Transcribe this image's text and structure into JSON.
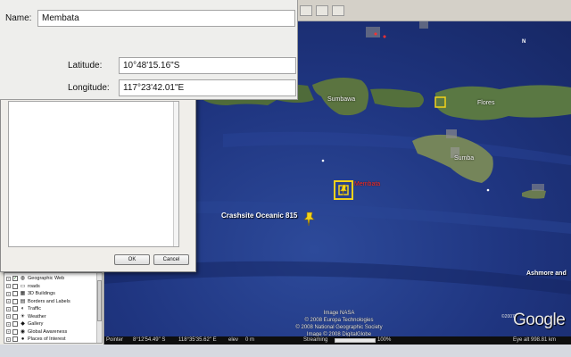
{
  "form": {
    "name_label": "Name:",
    "name_value": "Membata",
    "latitude_label": "Latitude:",
    "latitude_value": "10°48'15.16\"S",
    "longitude_label": "Longitude:",
    "longitude_value": "117°23'42.01\"E"
  },
  "dialog": {
    "ok_label": "OK",
    "cancel_label": "Cancel"
  },
  "map": {
    "labels": {
      "sumbawa": "Sumbawa",
      "flores": "Flores",
      "sumba": "Sumba",
      "membata": "Membata",
      "crashsite": "Crashsite Oceanic 815",
      "ashmore": "Ashmore and"
    },
    "attribution": {
      "line1": "Image NASA",
      "line2": "© 2008 Europa Technologies",
      "line3": "© 2008 National Geographic Society",
      "line4": "Image © 2008 DigitalGlobe"
    },
    "logo_prefix": "©2007",
    "logo": "Google"
  },
  "statusbar": {
    "pointer_label": "Pointer",
    "pointer_lat": "8°12'54.49\" S",
    "pointer_lon": "118°35'35.62\" E",
    "elev_label": "elev",
    "elev_value": "0 m",
    "streaming_label": "Streaming",
    "streaming_percent": "100%",
    "streaming_fraction": 1.0,
    "eye_alt_label": "Eye alt",
    "eye_alt_value": "998.81 km"
  },
  "layers": [
    {
      "label": "Geographic Web",
      "icon": "globe-web-icon",
      "checked": true
    },
    {
      "label": "roads",
      "icon": "roads-icon",
      "checked": false
    },
    {
      "label": "3D Buildings",
      "icon": "buildings-icon",
      "checked": false
    },
    {
      "label": "Borders and Labels",
      "icon": "borders-icon",
      "checked": false
    },
    {
      "label": "Traffic",
      "icon": "traffic-icon",
      "checked": false
    },
    {
      "label": "Weather",
      "icon": "weather-icon",
      "checked": false
    },
    {
      "label": "Gallery",
      "icon": "gallery-icon",
      "checked": false
    },
    {
      "label": "Global Awareness",
      "icon": "global-awareness-icon",
      "checked": false
    },
    {
      "label": "Places of Interest",
      "icon": "places-icon",
      "checked": false
    }
  ],
  "nav": {
    "north_label": "N"
  },
  "colors": {
    "ocean": "#1f3580",
    "placemark_yellow": "#f2d21b",
    "label_red": "#ff3030"
  }
}
